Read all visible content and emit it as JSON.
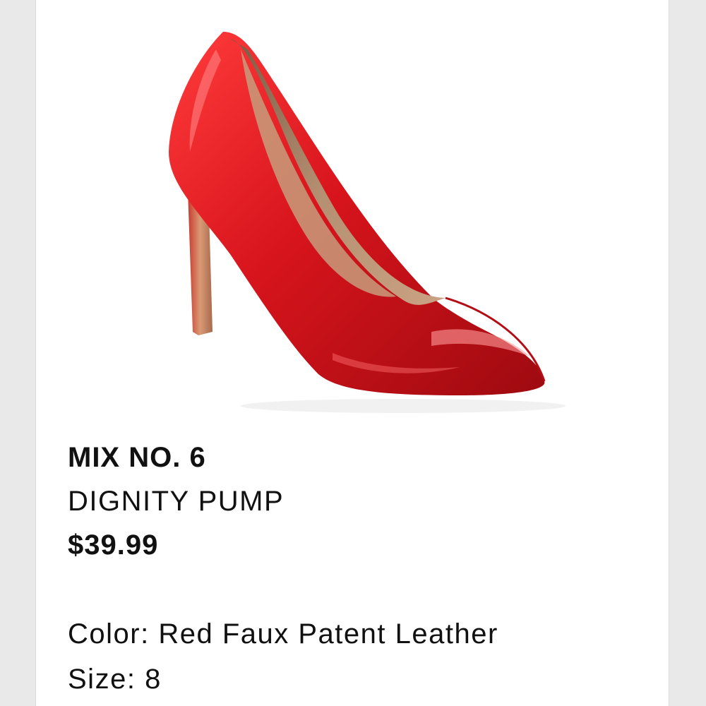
{
  "product": {
    "brand": "MIX NO. 6",
    "name": "DIGNITY PUMP",
    "price": "$39.99",
    "color_label": "Color:",
    "color_value": "Red Faux Patent Leather",
    "size_label": "Size:",
    "size_value": "8",
    "image_icon": "red-pointed-toe-pump-image"
  },
  "colors": {
    "page_background": "#e9e9e9",
    "card_background": "#ffffff",
    "shoe_red": "#d7141c",
    "text": "#111111"
  }
}
